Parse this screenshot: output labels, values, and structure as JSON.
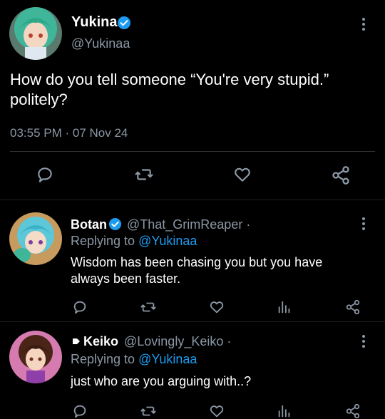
{
  "main_tweet": {
    "display_name": "Yukina",
    "handle": "@Yukinaa",
    "text_line1": "How do you tell someone “You're very stupid.”",
    "text_line2": "politely?",
    "timestamp": "03:55 PM · 07 Nov 24"
  },
  "replies": [
    {
      "display_name": "Botan",
      "handle": "@That_GrimReaper ·",
      "replying_prefix": "Replying to ",
      "replying_handle": "@Yukinaa",
      "text_line1": "Wisdom has been chasing you but you have",
      "text_line2": "always been faster."
    },
    {
      "display_name": "Keiko",
      "handle": "@Lovingly_Keiko ·",
      "replying_prefix": "Replying to ",
      "replying_handle": "@Yukinaa",
      "text_line1": "just who are you arguing with..?"
    }
  ],
  "colors": {
    "background": "#000000",
    "primary_text": "#e7e9ea",
    "secondary_text": "#8b98a5",
    "link": "#1d9bf0",
    "verified_badge": "#1d9bf0"
  },
  "icons": [
    "verified-badge-icon",
    "more-options-icon",
    "reply-icon",
    "retweet-icon",
    "like-icon",
    "share-icon",
    "analytics-icon",
    "thread-indicator-icon"
  ]
}
